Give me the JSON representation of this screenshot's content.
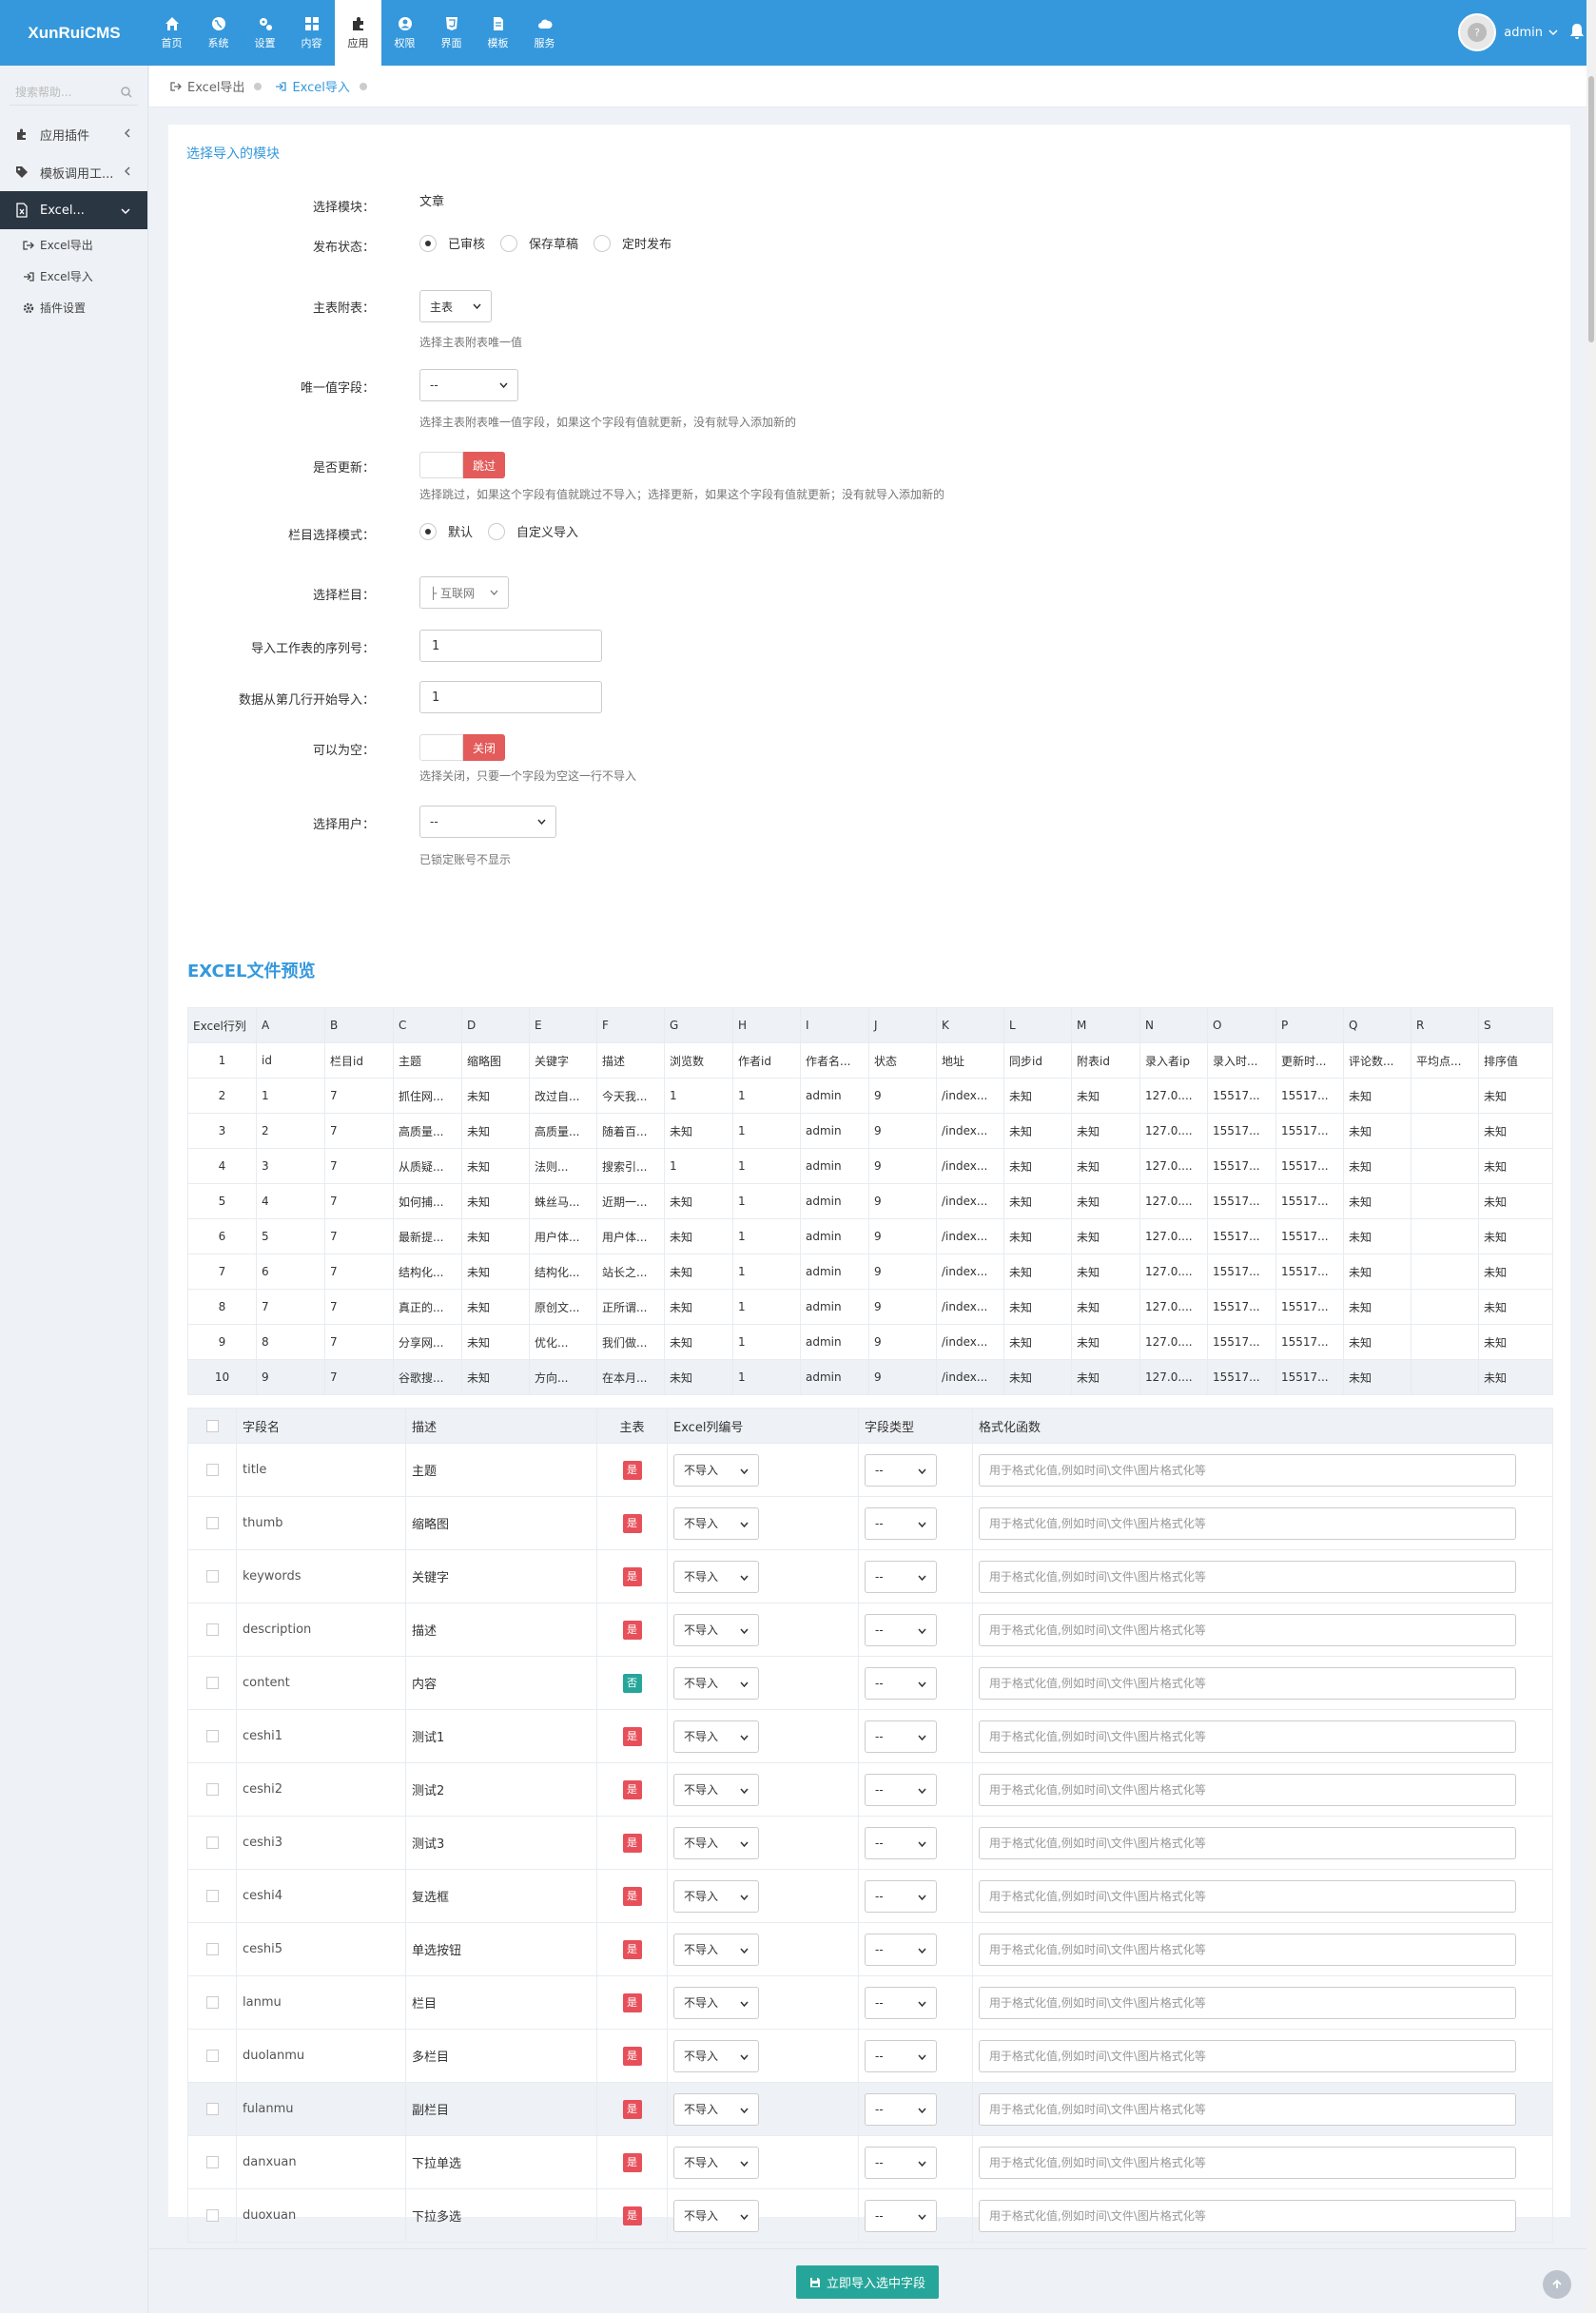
{
  "app": {
    "logo": "XunRuiCMS"
  },
  "nav": [
    {
      "label": "首页",
      "icon": "home-icon"
    },
    {
      "label": "系统",
      "icon": "globe-icon"
    },
    {
      "label": "设置",
      "icon": "cogs-icon"
    },
    {
      "label": "内容",
      "icon": "grid-icon"
    },
    {
      "label": "应用",
      "icon": "puzzle-icon",
      "active": true
    },
    {
      "label": "权限",
      "icon": "user-circle-icon"
    },
    {
      "label": "界面",
      "icon": "html5-icon"
    },
    {
      "label": "模板",
      "icon": "file-icon"
    },
    {
      "label": "服务",
      "icon": "cloud-icon"
    }
  ],
  "user": {
    "name": "admin"
  },
  "sidebar": {
    "search_placeholder": "搜索帮助...",
    "items": [
      {
        "label": "应用插件",
        "icon": "puzzle-icon"
      },
      {
        "label": "模板调用工...",
        "icon": "tag-icon"
      },
      {
        "label": "Excel...",
        "icon": "excel-icon",
        "active": true
      }
    ],
    "sub": [
      {
        "label": "Excel导出",
        "icon": "sign-out-icon"
      },
      {
        "label": "Excel导入",
        "icon": "sign-in-icon",
        "active": true
      },
      {
        "label": "插件设置",
        "icon": "gear-icon"
      }
    ]
  },
  "breadcrumb": [
    {
      "label": "Excel导出"
    },
    {
      "label": "Excel导入"
    }
  ],
  "form": {
    "section_title": "选择导入的模块",
    "module_label": "选择模块：",
    "module_value": "文章",
    "status_label": "发布状态：",
    "status_options": [
      "已审核",
      "保存草稿",
      "定时发布"
    ],
    "table_label": "主表附表：",
    "table_value": "主表",
    "table_help": "选择主表附表唯一值",
    "unique_label": "唯一值字段：",
    "unique_value": "--",
    "unique_help": "选择主表附表唯一值字段，如果这个字段有值就更新，没有就导入添加新的",
    "update_label": "是否更新：",
    "update_value": "跳过",
    "update_help": "选择跳过，如果这个字段有值就跳过不导入；选择更新，如果这个字段有值就更新；没有就导入添加新的",
    "catmode_label": "栏目选择模式：",
    "catmode_options": [
      "默认",
      "自定义导入"
    ],
    "cat_label": "选择栏目：",
    "cat_value": "├ 互联网",
    "sheet_label": "导入工作表的序列号：",
    "sheet_value": "1",
    "startrow_label": "数据从第几行开始导入：",
    "startrow_value": "1",
    "empty_label": "可以为空：",
    "empty_value": "关闭",
    "empty_help": "选择关闭，只要一个字段为空这一行不导入",
    "user_label": "选择用户：",
    "user_value": "--",
    "user_help": "已锁定账号不显示"
  },
  "excel_preview": {
    "title": "EXCEL文件预览",
    "headers": [
      "Excel行列",
      "A",
      "B",
      "C",
      "D",
      "E",
      "F",
      "G",
      "H",
      "I",
      "J",
      "K",
      "L",
      "M",
      "N",
      "O",
      "P",
      "Q",
      "R",
      "S"
    ],
    "rows": [
      [
        "1",
        "id",
        "栏目id",
        "主题",
        "缩略图",
        "关键字",
        "描述",
        "浏览数",
        "作者id",
        "作者名...",
        "状态",
        "地址",
        "同步id",
        "附表id",
        "录入者ip",
        "录入时...",
        "更新时...",
        "评论数...",
        "平均点...",
        "排序值"
      ],
      [
        "2",
        "1",
        "7",
        "抓住网...",
        "未知",
        "改过自...",
        "今天我...",
        "1",
        "1",
        "admin",
        "9",
        "/index...",
        "未知",
        "未知",
        "127.0....",
        "15517...",
        "15517...",
        "未知",
        "",
        "未知"
      ],
      [
        "3",
        "2",
        "7",
        "高质量...",
        "未知",
        "高质量...",
        "随着百...",
        "未知",
        "1",
        "admin",
        "9",
        "/index...",
        "未知",
        "未知",
        "127.0....",
        "15517...",
        "15517...",
        "未知",
        "",
        "未知"
      ],
      [
        "4",
        "3",
        "7",
        "从质疑...",
        "未知",
        "法则...",
        "搜索引...",
        "1",
        "1",
        "admin",
        "9",
        "/index...",
        "未知",
        "未知",
        "127.0....",
        "15517...",
        "15517...",
        "未知",
        "",
        "未知"
      ],
      [
        "5",
        "4",
        "7",
        "如何捕...",
        "未知",
        "蛛丝马...",
        "近期一...",
        "未知",
        "1",
        "admin",
        "9",
        "/index...",
        "未知",
        "未知",
        "127.0....",
        "15517...",
        "15517...",
        "未知",
        "",
        "未知"
      ],
      [
        "6",
        "5",
        "7",
        "最新提...",
        "未知",
        "用户体...",
        "用户体...",
        "未知",
        "1",
        "admin",
        "9",
        "/index...",
        "未知",
        "未知",
        "127.0....",
        "15517...",
        "15517...",
        "未知",
        "",
        "未知"
      ],
      [
        "7",
        "6",
        "7",
        "结构化...",
        "未知",
        "结构化...",
        "站长之...",
        "未知",
        "1",
        "admin",
        "9",
        "/index...",
        "未知",
        "未知",
        "127.0....",
        "15517...",
        "15517...",
        "未知",
        "",
        "未知"
      ],
      [
        "8",
        "7",
        "7",
        "真正的...",
        "未知",
        "原创文...",
        "正所谓...",
        "未知",
        "1",
        "admin",
        "9",
        "/index...",
        "未知",
        "未知",
        "127.0....",
        "15517...",
        "15517...",
        "未知",
        "",
        "未知"
      ],
      [
        "9",
        "8",
        "7",
        "分享网...",
        "未知",
        "优化...",
        "我们做...",
        "未知",
        "1",
        "admin",
        "9",
        "/index...",
        "未知",
        "未知",
        "127.0....",
        "15517...",
        "15517...",
        "未知",
        "",
        "未知"
      ],
      [
        "10",
        "9",
        "7",
        "谷歌搜...",
        "未知",
        "方向...",
        "在本月...",
        "未知",
        "1",
        "admin",
        "9",
        "/index...",
        "未知",
        "未知",
        "127.0....",
        "15517...",
        "15517...",
        "未知",
        "",
        "未知"
      ]
    ]
  },
  "fields": {
    "headers": [
      "",
      "字段名",
      "描述",
      "主表",
      "Excel列编号",
      "字段类型",
      "格式化函数"
    ],
    "import_default": "不导入",
    "type_default": "--",
    "fmt_placeholder": "用于格式化值,例如时间\\文件\\图片格式化等",
    "yes": "是",
    "no": "否",
    "colors": {
      "yes": "#e7505a",
      "no": "#26a69a"
    },
    "rows": [
      {
        "name": "title",
        "desc": "主题",
        "main": "是"
      },
      {
        "name": "thumb",
        "desc": "缩略图",
        "main": "是"
      },
      {
        "name": "keywords",
        "desc": "关键字",
        "main": "是"
      },
      {
        "name": "description",
        "desc": "描述",
        "main": "是"
      },
      {
        "name": "content",
        "desc": "内容",
        "main": "否"
      },
      {
        "name": "ceshi1",
        "desc": "测试1",
        "main": "是"
      },
      {
        "name": "ceshi2",
        "desc": "测试2",
        "main": "是"
      },
      {
        "name": "ceshi3",
        "desc": "测试3",
        "main": "是"
      },
      {
        "name": "ceshi4",
        "desc": "复选框",
        "main": "是"
      },
      {
        "name": "ceshi5",
        "desc": "单选按钮",
        "main": "是"
      },
      {
        "name": "lanmu",
        "desc": "栏目",
        "main": "是"
      },
      {
        "name": "duolanmu",
        "desc": "多栏目",
        "main": "是"
      },
      {
        "name": "fulanmu",
        "desc": "副栏目",
        "main": "是"
      },
      {
        "name": "danxuan",
        "desc": "下拉单选",
        "main": "是"
      },
      {
        "name": "duoxuan",
        "desc": "下拉多选",
        "main": "是"
      }
    ]
  },
  "footer": {
    "submit_label": "立即导入选中字段"
  }
}
